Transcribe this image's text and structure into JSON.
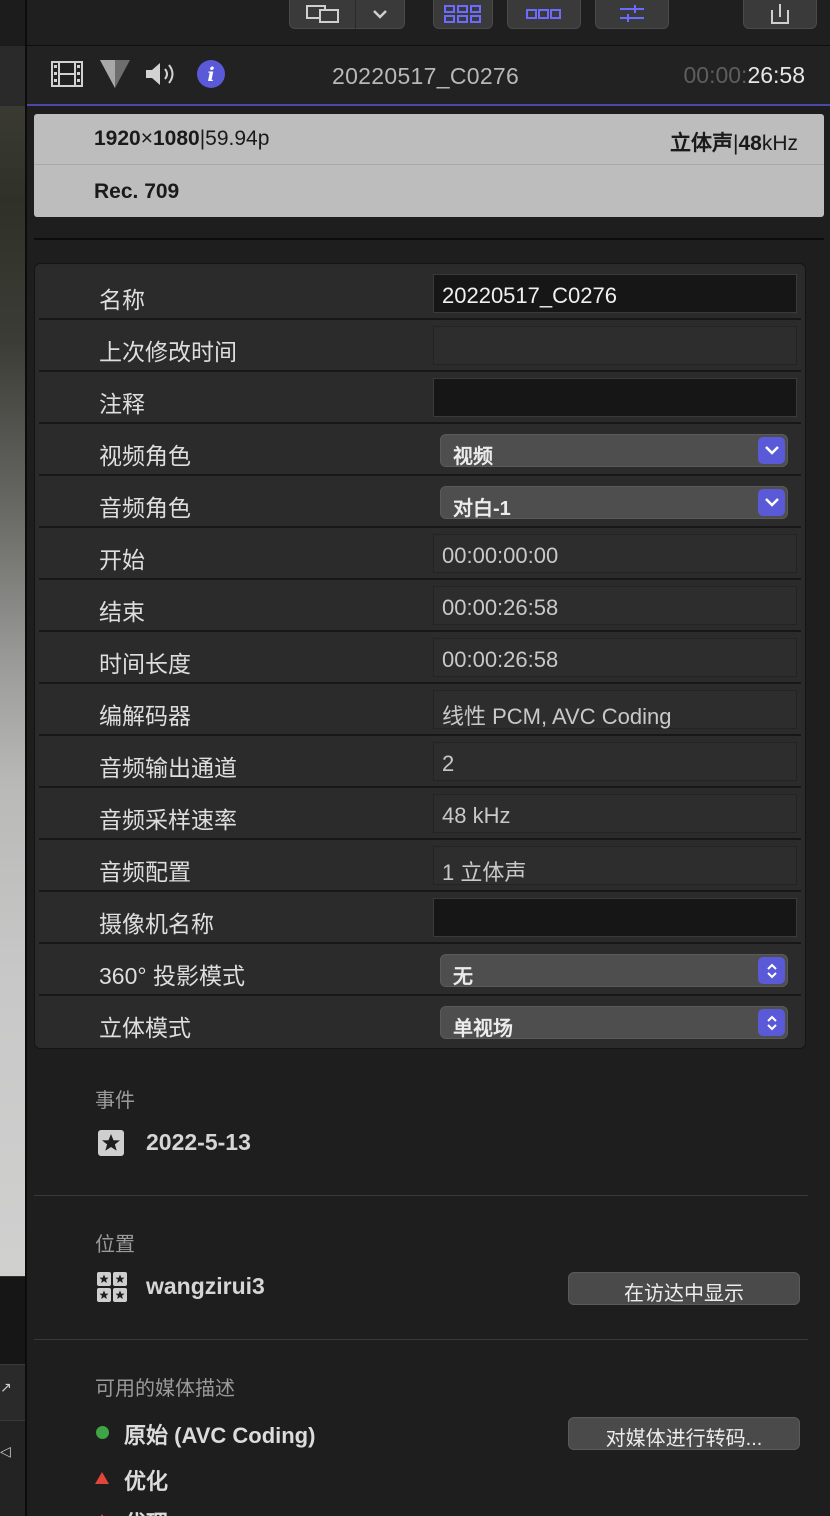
{
  "header": {
    "clip_name": "20220517_C0276",
    "timecode_dim": "00:00:",
    "timecode_bright": "26:58"
  },
  "summary": {
    "width": "1920",
    "times": "×",
    "height": "1080",
    "sep": "|",
    "frame_rate": "59.94p",
    "audio_channels": "立体声",
    "audio_sep": "|",
    "audio_rate_num": "48",
    "audio_rate_unit": "kHz",
    "color_space": "Rec. 709"
  },
  "properties": [
    {
      "label": "名称",
      "value": "20220517_C0276",
      "kind": "editable"
    },
    {
      "label": "上次修改时间",
      "value": "",
      "kind": "readonly"
    },
    {
      "label": "注释",
      "value": "",
      "kind": "editable"
    },
    {
      "label": "视频角色",
      "value": "视频",
      "kind": "select"
    },
    {
      "label": "音频角色",
      "value": "对白-1",
      "kind": "select"
    },
    {
      "label": "开始",
      "value": "00:00:00:00",
      "kind": "readonly"
    },
    {
      "label": "结束",
      "value": "00:00:26:58",
      "kind": "readonly"
    },
    {
      "label": "时间长度",
      "value": "00:00:26:58",
      "kind": "readonly"
    },
    {
      "label": "编解码器",
      "value": "线性 PCM, AVC Coding",
      "kind": "readonly"
    },
    {
      "label": "音频输出通道",
      "value": "2",
      "kind": "readonly"
    },
    {
      "label": "音频采样速率",
      "value": "48 kHz",
      "kind": "readonly"
    },
    {
      "label": "音频配置",
      "value": "1 立体声",
      "kind": "readonly"
    },
    {
      "label": "摄像机名称",
      "value": "",
      "kind": "editable"
    },
    {
      "label": "360° 投影模式",
      "value": "无",
      "kind": "popup"
    },
    {
      "label": "立体模式",
      "value": "单视场",
      "kind": "popup"
    }
  ],
  "event": {
    "title": "事件",
    "value": "2022-5-13"
  },
  "location": {
    "title": "位置",
    "value": "wangzirui3",
    "button": "在访达中显示"
  },
  "media": {
    "title": "可用的媒体描述",
    "original": "原始 (AVC Coding)",
    "optimized": "优化",
    "proxy": "代理",
    "button": "对媒体进行转码..."
  },
  "colors": {
    "accent": "#5a59d8",
    "header_rule": "#4a49a8",
    "status_ok": "#3fa544",
    "status_missing": "#e0463a"
  }
}
